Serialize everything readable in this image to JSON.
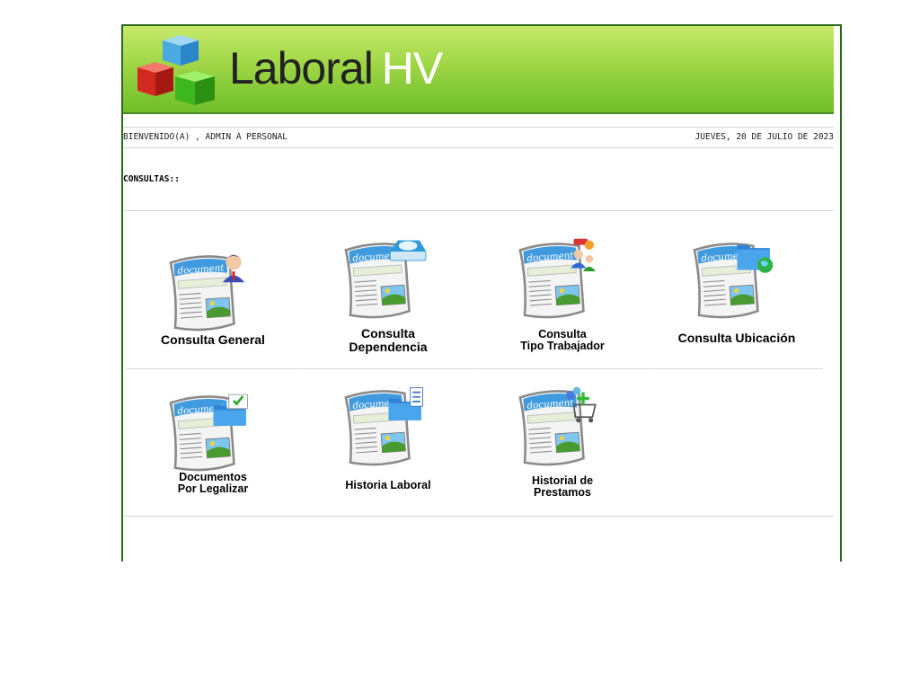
{
  "header": {
    "logo_word1": "Laboral",
    "logo_word2": "HV"
  },
  "welcome_bar": {
    "greeting": "BIENVENIDO(A) , ADMIN A PERSONAL",
    "date": "JUEVES, 20 DE JULIO DE 2023"
  },
  "section_title": "CONSULTAS::",
  "doc_word": "document",
  "tiles": [
    {
      "label": "Consulta General",
      "badge": "person-icon"
    },
    {
      "label": "Consulta\nDependencia",
      "badge": "drive-icon"
    },
    {
      "label": "Consulta\nTipo Trabajador",
      "badge": "workers-icon"
    },
    {
      "label": "Consulta Ubicación",
      "badge": "folder-globe-icon"
    },
    {
      "label": "Documentos\nPor Legalizar",
      "badge": "folder-check-icon"
    },
    {
      "label": "Historia Laboral",
      "badge": "folder-list-icon"
    },
    {
      "label": "Historial de\nPrestamos",
      "badge": "cart-add-icon"
    }
  ],
  "colors": {
    "banner_top": "#c6e96a",
    "banner_bottom": "#6fbe2a",
    "frame_border": "#2c6a1e"
  }
}
